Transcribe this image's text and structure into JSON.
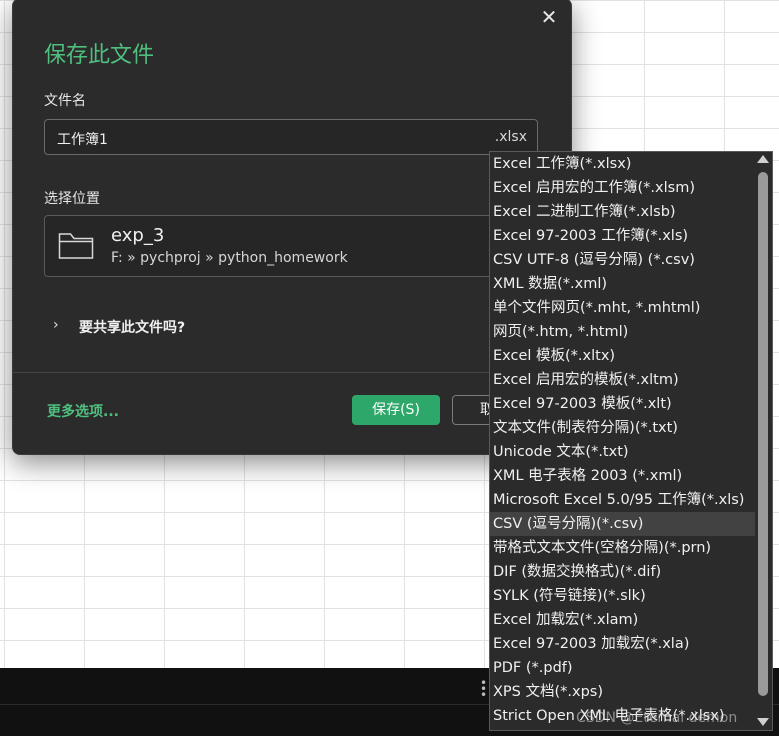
{
  "dialog": {
    "close_glyph": "✕",
    "title": "保存此文件",
    "filename_label": "文件名",
    "filename_value": "工作簿1",
    "filename_ext": ".xlsx",
    "location_label": "选择位置",
    "location_name": "exp_3",
    "location_path": "F: » pychproj » python_homework",
    "share_chevron": "›",
    "share_label": "要共享此文件吗?",
    "more_options": "更多选项...",
    "save_button": "保存(S)",
    "cancel_button": "取"
  },
  "file_types": [
    "Excel 工作簿(*.xlsx)",
    "Excel 启用宏的工作簿(*.xlsm)",
    "Excel 二进制工作簿(*.xlsb)",
    "Excel 97-2003 工作簿(*.xls)",
    "CSV UTF-8 (逗号分隔) (*.csv)",
    "XML 数据(*.xml)",
    "单个文件网页(*.mht, *.mhtml)",
    "网页(*.htm, *.html)",
    "Excel 模板(*.xltx)",
    "Excel 启用宏的模板(*.xltm)",
    "Excel 97-2003 模板(*.xlt)",
    "文本文件(制表符分隔)(*.txt)",
    "Unicode 文本(*.txt)",
    "XML 电子表格 2003 (*.xml)",
    "Microsoft Excel 5.0/95 工作簿(*.xls)",
    "CSV (逗号分隔)(*.csv)",
    "带格式文本文件(空格分隔)(*.prn)",
    "DIF (数据交换格式)(*.dif)",
    "SYLK (符号链接)(*.slk)",
    "Excel 加载宏(*.xlam)",
    "Excel 97-2003 加载宏(*.xla)",
    "PDF (*.pdf)",
    "XPS 文档(*.xps)",
    "Strict Open XML 电子表格(*.xlsx)"
  ],
  "selected_file_type": "CSV (逗号分隔)(*.csv)",
  "watermark": "CSDN @Eternal demon",
  "colors": {
    "accent_green": "#4fbf7f",
    "save_button_bg": "#2ea86a",
    "dialog_bg": "#2b2b2b"
  }
}
